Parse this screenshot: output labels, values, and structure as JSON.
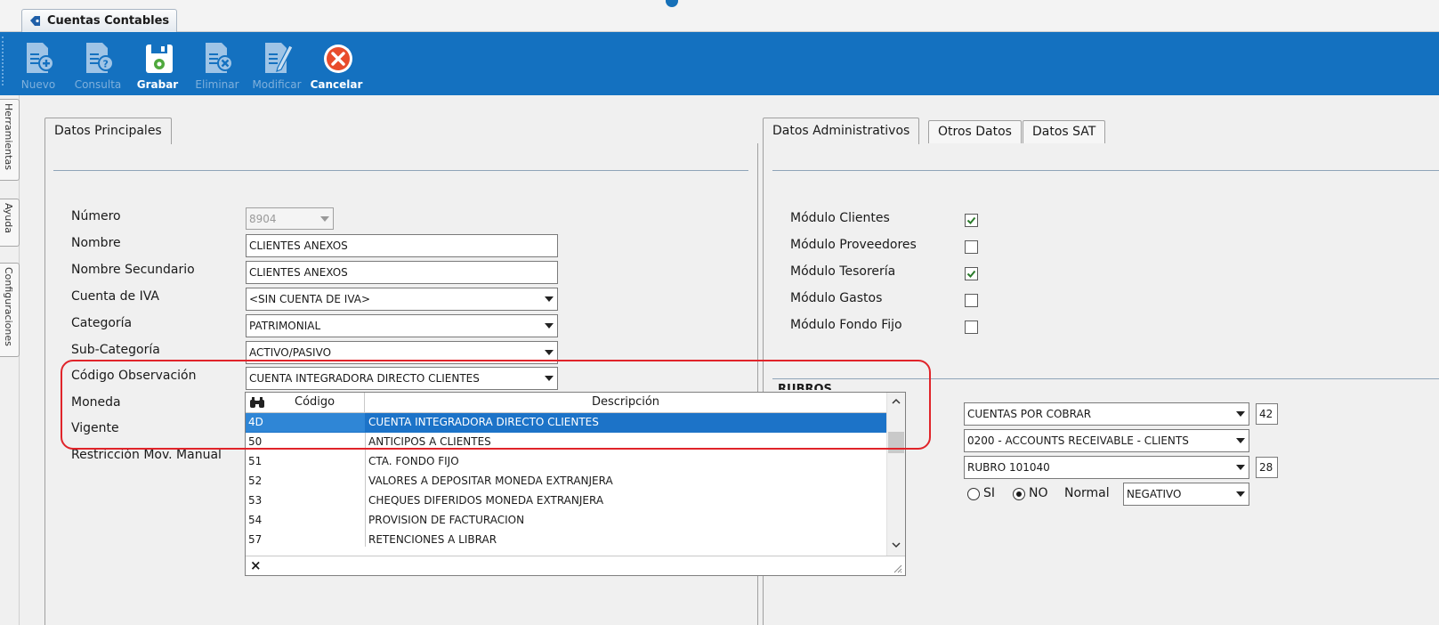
{
  "window": {
    "tab_title": "Cuentas Contables"
  },
  "toolbar": {
    "buttons": [
      {
        "label": "Nuevo",
        "icon": "new-document-icon",
        "enabled": false
      },
      {
        "label": "Consulta",
        "icon": "query-document-icon",
        "enabled": false
      },
      {
        "label": "Grabar",
        "icon": "save-disk-icon",
        "enabled": true
      },
      {
        "label": "Eliminar",
        "icon": "delete-document-icon",
        "enabled": false
      },
      {
        "label": "Modificar",
        "icon": "edit-document-icon",
        "enabled": false
      },
      {
        "label": "Cancelar",
        "icon": "cancel-x-icon",
        "enabled": true
      }
    ]
  },
  "side_tabs": [
    "Herramientas",
    "Ayuda",
    "Configuraciones"
  ],
  "left_panel": {
    "tab": "Datos Principales",
    "labels": {
      "numero": "Número",
      "nombre": "Nombre",
      "nombre_secundario": "Nombre Secundario",
      "cuenta_iva": "Cuenta de IVA",
      "categoria": "Categoría",
      "sub_categoria": "Sub-Categoría",
      "codigo_observacion": "Código Observación",
      "moneda": "Moneda",
      "vigente": "Vigente",
      "restriccion": "Restricción Mov. Manual"
    },
    "values": {
      "numero": "8904",
      "nombre": "CLIENTES ANEXOS",
      "nombre_secundario": "CLIENTES ANEXOS",
      "cuenta_iva": "<SIN CUENTA DE IVA>",
      "categoria": "PATRIMONIAL",
      "sub_categoria": "ACTIVO/PASIVO",
      "codigo_observacion": "CUENTA INTEGRADORA DIRECTO CLIENTES"
    }
  },
  "dropdown_grid": {
    "columns": {
      "code": "Código",
      "desc": "Descripción"
    },
    "rows": [
      {
        "code": "4D",
        "desc": "CUENTA INTEGRADORA DIRECTO CLIENTES",
        "selected": true
      },
      {
        "code": "50",
        "desc": "ANTICIPOS A CLIENTES"
      },
      {
        "code": "51",
        "desc": "CTA. FONDO FIJO"
      },
      {
        "code": "52",
        "desc": "VALORES A DEPOSITAR MONEDA EXTRANJERA"
      },
      {
        "code": "53",
        "desc": "CHEQUES DIFERIDOS MONEDA EXTRANJERA"
      },
      {
        "code": "54",
        "desc": "PROVISION DE FACTURACION"
      },
      {
        "code": "57",
        "desc": "RETENCIONES A LIBRAR"
      }
    ],
    "footer_close": "×"
  },
  "right_panel": {
    "tabs": [
      "Datos Administrativos",
      "Otros Datos",
      "Datos SAT"
    ],
    "modules": [
      {
        "label": "Módulo Clientes",
        "checked": true
      },
      {
        "label": "Módulo Proveedores",
        "checked": false
      },
      {
        "label": "Módulo Tesorería",
        "checked": true
      },
      {
        "label": "Módulo Gastos",
        "checked": false
      },
      {
        "label": "Módulo Fondo Fijo",
        "checked": false
      }
    ],
    "rubros_title": "RUBROS",
    "rubro1": {
      "value": "CUENTAS POR COBRAR",
      "num": "42"
    },
    "rubro2": {
      "value": "0200 - ACCOUNTS RECEIVABLE - CLIENTS"
    },
    "rubro3": {
      "value": "RUBRO 101040",
      "num": "28"
    },
    "radio_si": "SI",
    "radio_no": "NO",
    "radio_selected": "NO",
    "normal_label": "Normal",
    "normal_value": "NEGATIVO"
  },
  "colors": {
    "toolbar": "#1471c0",
    "selection": "#1c73c8",
    "highlight": "#e0242a"
  }
}
